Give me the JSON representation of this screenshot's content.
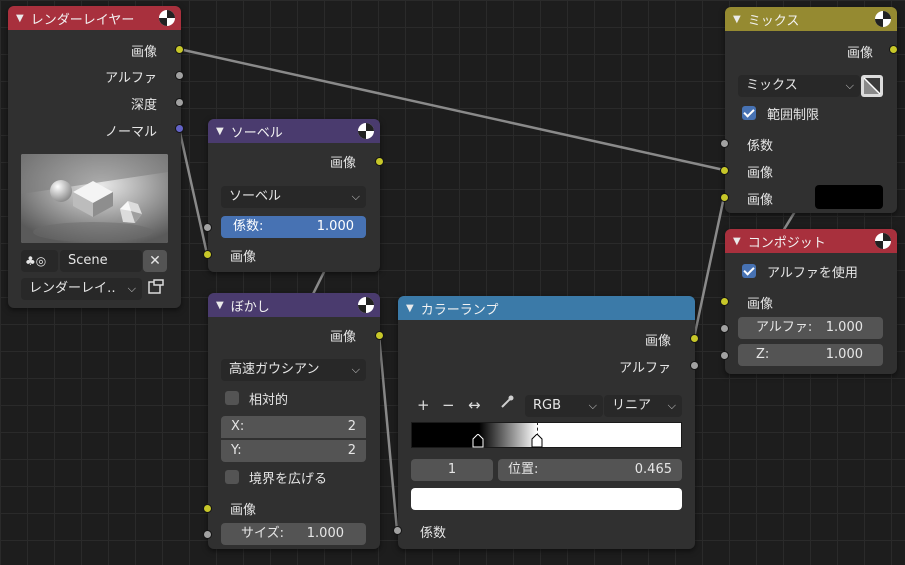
{
  "render_layers": {
    "title": "レンダーレイヤー",
    "outputs": [
      "画像",
      "アルファ",
      "深度",
      "ノーマル"
    ],
    "scene": "Scene",
    "layer": "レンダーレイ‥"
  },
  "sobel": {
    "title": "ソーベル",
    "output": "画像",
    "filter": "ソーベル",
    "factor_label": "係数:",
    "factor_value": "1.000",
    "input": "画像"
  },
  "blur": {
    "title": "ぼかし",
    "output": "画像",
    "filter": "高速ガウシアン",
    "relative": "相対的",
    "x_label": "X:",
    "x_value": "2",
    "y_label": "Y:",
    "y_value": "2",
    "extend": "境界を広げる",
    "input": "画像",
    "size_label": "サイズ:",
    "size_value": "1.000"
  },
  "ramp": {
    "title": "カラーランプ",
    "outputs": [
      "画像",
      "アルファ"
    ],
    "plus": "+",
    "minus": "−",
    "flip": "↔",
    "color_mode": "RGB",
    "interpolation": "リニア",
    "active_index": "1",
    "position_label": "位置:",
    "position_value": "0.465",
    "selected_color": "#ffffff",
    "input": "係数"
  },
  "mix": {
    "title": "ミックス",
    "output": "画像",
    "blend": "ミックス",
    "clamp": "範囲制限",
    "inputs": [
      "係数",
      "画像",
      "画像"
    ],
    "color2": "#000000"
  },
  "composite": {
    "title": "コンポジット",
    "use_alpha": "アルファを使用",
    "input": "画像",
    "alpha_label": "アルファ:",
    "alpha_value": "1.000",
    "z_label": "Z:",
    "z_value": "1.000"
  },
  "colors": {
    "header_red": "#a8303d",
    "header_purple": "#4a3b6e",
    "header_blue": "#3b7aa8",
    "header_olive": "#958a31",
    "socket_image": "#c7c729",
    "socket_float": "#a1a1a1",
    "socket_vector": "#6363c7",
    "accent": "#4772b3"
  }
}
